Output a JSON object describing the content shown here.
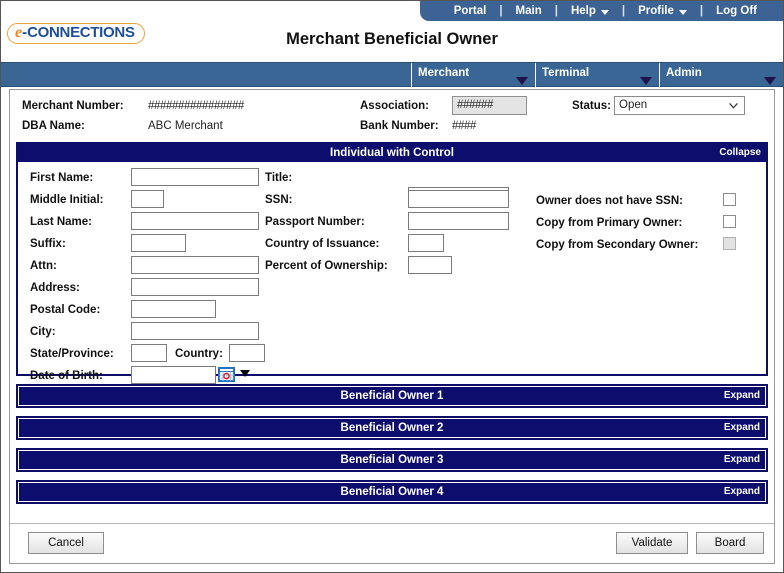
{
  "topnav": {
    "items": [
      {
        "label": "Portal",
        "caret": false
      },
      {
        "label": "Main",
        "caret": false
      },
      {
        "label": "Help",
        "caret": true
      },
      {
        "label": "Profile",
        "caret": true
      },
      {
        "label": "Log Off",
        "caret": false
      }
    ],
    "separator": "|"
  },
  "brand": {
    "e": "e",
    "dash": "-",
    "word": "CONNECTIONS"
  },
  "header": {
    "title": "Merchant Beneficial Owner"
  },
  "mainnav": {
    "tabs": [
      {
        "label": "Merchant"
      },
      {
        "label": "Terminal"
      },
      {
        "label": "Admin"
      }
    ]
  },
  "merchant_info": {
    "merchant_number_label": "Merchant Number:",
    "merchant_number_value": "################",
    "dba_name_label": "DBA Name:",
    "dba_name_value": "ABC Merchant",
    "association_label": "Association:",
    "association_value": "######",
    "bank_number_label": "Bank Number:",
    "bank_number_value": "####",
    "status_label": "Status:",
    "status_value": "Open"
  },
  "individual_panel": {
    "title": "Individual with Control",
    "toggle": "Collapse",
    "fields": {
      "first_name_label": "First Name:",
      "first_name_value": "",
      "middle_initial_label": "Middle Initial:",
      "middle_initial_value": "",
      "last_name_label": "Last Name:",
      "last_name_value": "",
      "suffix_label": "Suffix:",
      "suffix_value": "",
      "attn_label": "Attn:",
      "attn_value": "",
      "address_label": "Address:",
      "address_value": "",
      "postal_code_label": "Postal Code:",
      "postal_code_value": "",
      "city_label": "City:",
      "city_value": "",
      "state_province_label": "State/Province:",
      "state_province_value": "",
      "country_label": "Country:",
      "country_value": "",
      "date_of_birth_label": "Date of Birth:",
      "date_of_birth_value": "",
      "title_label": "Title:",
      "title_value": "",
      "ssn_label": "SSN:",
      "ssn_value": "",
      "passport_number_label": "Passport Number:",
      "passport_number_value": "",
      "country_of_issuance_label": "Country of Issuance:",
      "country_of_issuance_value": "",
      "percent_of_ownership_label": "Percent of Ownership:",
      "percent_of_ownership_value": ""
    },
    "checkboxes": [
      {
        "label": "Owner does not have SSN:",
        "checked": false,
        "disabled": false
      },
      {
        "label": "Copy from Primary Owner:",
        "checked": false,
        "disabled": false
      },
      {
        "label": "Copy from Secondary Owner:",
        "checked": false,
        "disabled": true
      }
    ]
  },
  "beneficial_owners": [
    {
      "title": "Beneficial Owner 1",
      "toggle": "Expand"
    },
    {
      "title": "Beneficial Owner 2",
      "toggle": "Expand"
    },
    {
      "title": "Beneficial Owner 3",
      "toggle": "Expand"
    },
    {
      "title": "Beneficial Owner 4",
      "toggle": "Expand"
    }
  ],
  "footer": {
    "cancel": "Cancel",
    "validate": "Validate",
    "board": "Board"
  },
  "colors": {
    "topbar": "#3d6394",
    "navband": "#3a6695",
    "panel_navy": "#0d0d6e",
    "logo_orange": "#e8871e",
    "logo_blue": "#1b4f9c"
  }
}
